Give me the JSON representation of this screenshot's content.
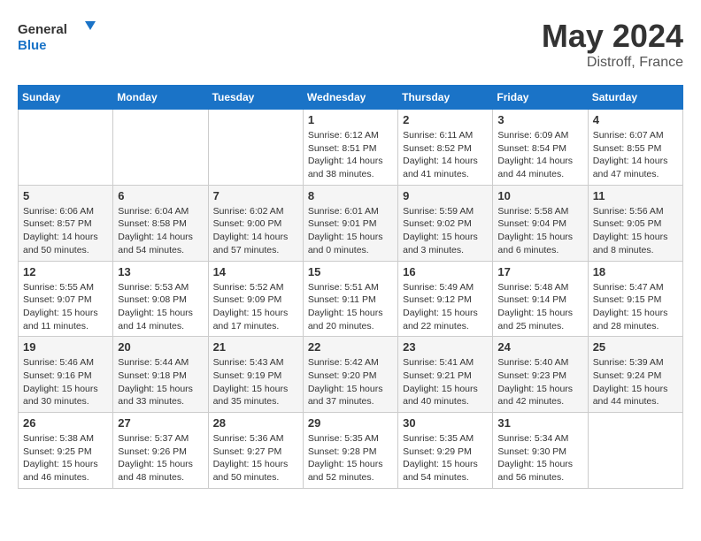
{
  "header": {
    "logo_line1": "General",
    "logo_line2": "Blue",
    "month_title": "May 2024",
    "subtitle": "Distroff, France"
  },
  "weekdays": [
    "Sunday",
    "Monday",
    "Tuesday",
    "Wednesday",
    "Thursday",
    "Friday",
    "Saturday"
  ],
  "weeks": [
    [
      {
        "day": "",
        "info": ""
      },
      {
        "day": "",
        "info": ""
      },
      {
        "day": "",
        "info": ""
      },
      {
        "day": "1",
        "info": "Sunrise: 6:12 AM\nSunset: 8:51 PM\nDaylight: 14 hours\nand 38 minutes."
      },
      {
        "day": "2",
        "info": "Sunrise: 6:11 AM\nSunset: 8:52 PM\nDaylight: 14 hours\nand 41 minutes."
      },
      {
        "day": "3",
        "info": "Sunrise: 6:09 AM\nSunset: 8:54 PM\nDaylight: 14 hours\nand 44 minutes."
      },
      {
        "day": "4",
        "info": "Sunrise: 6:07 AM\nSunset: 8:55 PM\nDaylight: 14 hours\nand 47 minutes."
      }
    ],
    [
      {
        "day": "5",
        "info": "Sunrise: 6:06 AM\nSunset: 8:57 PM\nDaylight: 14 hours\nand 50 minutes."
      },
      {
        "day": "6",
        "info": "Sunrise: 6:04 AM\nSunset: 8:58 PM\nDaylight: 14 hours\nand 54 minutes."
      },
      {
        "day": "7",
        "info": "Sunrise: 6:02 AM\nSunset: 9:00 PM\nDaylight: 14 hours\nand 57 minutes."
      },
      {
        "day": "8",
        "info": "Sunrise: 6:01 AM\nSunset: 9:01 PM\nDaylight: 15 hours\nand 0 minutes."
      },
      {
        "day": "9",
        "info": "Sunrise: 5:59 AM\nSunset: 9:02 PM\nDaylight: 15 hours\nand 3 minutes."
      },
      {
        "day": "10",
        "info": "Sunrise: 5:58 AM\nSunset: 9:04 PM\nDaylight: 15 hours\nand 6 minutes."
      },
      {
        "day": "11",
        "info": "Sunrise: 5:56 AM\nSunset: 9:05 PM\nDaylight: 15 hours\nand 8 minutes."
      }
    ],
    [
      {
        "day": "12",
        "info": "Sunrise: 5:55 AM\nSunset: 9:07 PM\nDaylight: 15 hours\nand 11 minutes."
      },
      {
        "day": "13",
        "info": "Sunrise: 5:53 AM\nSunset: 9:08 PM\nDaylight: 15 hours\nand 14 minutes."
      },
      {
        "day": "14",
        "info": "Sunrise: 5:52 AM\nSunset: 9:09 PM\nDaylight: 15 hours\nand 17 minutes."
      },
      {
        "day": "15",
        "info": "Sunrise: 5:51 AM\nSunset: 9:11 PM\nDaylight: 15 hours\nand 20 minutes."
      },
      {
        "day": "16",
        "info": "Sunrise: 5:49 AM\nSunset: 9:12 PM\nDaylight: 15 hours\nand 22 minutes."
      },
      {
        "day": "17",
        "info": "Sunrise: 5:48 AM\nSunset: 9:14 PM\nDaylight: 15 hours\nand 25 minutes."
      },
      {
        "day": "18",
        "info": "Sunrise: 5:47 AM\nSunset: 9:15 PM\nDaylight: 15 hours\nand 28 minutes."
      }
    ],
    [
      {
        "day": "19",
        "info": "Sunrise: 5:46 AM\nSunset: 9:16 PM\nDaylight: 15 hours\nand 30 minutes."
      },
      {
        "day": "20",
        "info": "Sunrise: 5:44 AM\nSunset: 9:18 PM\nDaylight: 15 hours\nand 33 minutes."
      },
      {
        "day": "21",
        "info": "Sunrise: 5:43 AM\nSunset: 9:19 PM\nDaylight: 15 hours\nand 35 minutes."
      },
      {
        "day": "22",
        "info": "Sunrise: 5:42 AM\nSunset: 9:20 PM\nDaylight: 15 hours\nand 37 minutes."
      },
      {
        "day": "23",
        "info": "Sunrise: 5:41 AM\nSunset: 9:21 PM\nDaylight: 15 hours\nand 40 minutes."
      },
      {
        "day": "24",
        "info": "Sunrise: 5:40 AM\nSunset: 9:23 PM\nDaylight: 15 hours\nand 42 minutes."
      },
      {
        "day": "25",
        "info": "Sunrise: 5:39 AM\nSunset: 9:24 PM\nDaylight: 15 hours\nand 44 minutes."
      }
    ],
    [
      {
        "day": "26",
        "info": "Sunrise: 5:38 AM\nSunset: 9:25 PM\nDaylight: 15 hours\nand 46 minutes."
      },
      {
        "day": "27",
        "info": "Sunrise: 5:37 AM\nSunset: 9:26 PM\nDaylight: 15 hours\nand 48 minutes."
      },
      {
        "day": "28",
        "info": "Sunrise: 5:36 AM\nSunset: 9:27 PM\nDaylight: 15 hours\nand 50 minutes."
      },
      {
        "day": "29",
        "info": "Sunrise: 5:35 AM\nSunset: 9:28 PM\nDaylight: 15 hours\nand 52 minutes."
      },
      {
        "day": "30",
        "info": "Sunrise: 5:35 AM\nSunset: 9:29 PM\nDaylight: 15 hours\nand 54 minutes."
      },
      {
        "day": "31",
        "info": "Sunrise: 5:34 AM\nSunset: 9:30 PM\nDaylight: 15 hours\nand 56 minutes."
      },
      {
        "day": "",
        "info": ""
      }
    ]
  ]
}
